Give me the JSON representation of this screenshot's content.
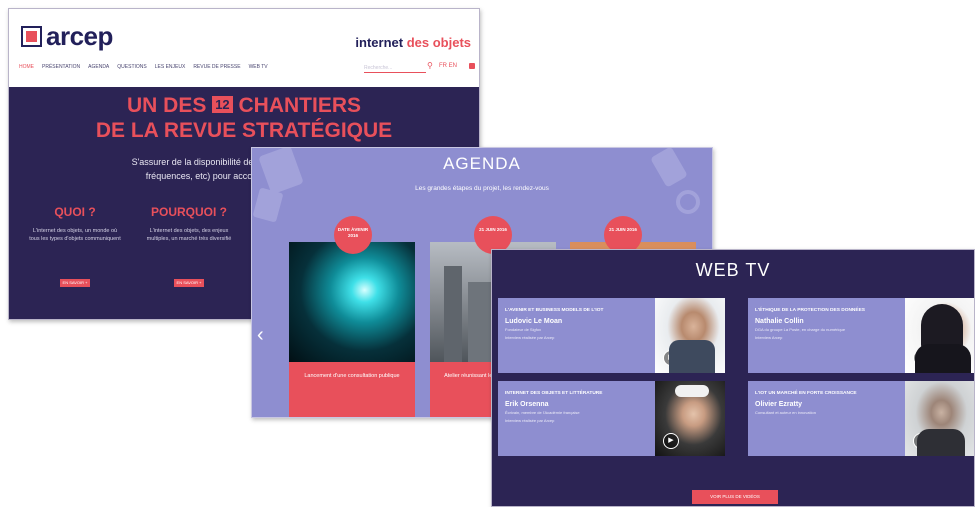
{
  "home": {
    "logo_text": "arcep",
    "header_brand_1": "internet",
    "header_brand_2": "des objets",
    "nav": [
      "HOME",
      "PRÉSENTATION",
      "AGENDA",
      "QUESTIONS",
      "LES ENJEUX",
      "REVUE DE PRESSE",
      "WEB TV"
    ],
    "search_placeholder": "Recherche...",
    "lang": "FR EN",
    "headline_1": "UN DES",
    "headline_num": "12",
    "headline_2": "CHANTIERS",
    "headline_3": "DE LA REVUE STRATÉGIQUE",
    "intro_1": "S'assurer de la disponibilité des ressources rares (num",
    "intro_2": "fréquences, etc) pour accompagner le développ",
    "columns": [
      {
        "title": "QUOI ?",
        "text": "L'internet des objets, un monde où tous les types d'objets communiquent",
        "button": "EN SAVOIR +"
      },
      {
        "title": "POURQUOI ?",
        "text": "L'internet des objets, des enjeux multiples, un marché très diversifié",
        "button": "EN SAVOIR +"
      }
    ]
  },
  "agenda": {
    "title": "AGENDA",
    "subtitle": "Les grandes étapes du projet, les rendez-vous",
    "prev_arrow": "‹",
    "cards": [
      {
        "date": "DATE ÀVENIR 2016",
        "caption": "Lancement d'une consultation publique"
      },
      {
        "date": "21 JUIN 2016",
        "caption": "Atelier réunissant les acteurs du secteur"
      },
      {
        "date": "21 JUIN 2016",
        "caption": ""
      }
    ]
  },
  "webtv": {
    "title": "WEB TV",
    "items": [
      {
        "title": "L'AVENIR ET BUSINESS MODELS DE L'IOT",
        "name": "Ludovic Le Moan",
        "role": "Fondateur de Sigfox",
        "detail": "Interview réalisée par Arcep"
      },
      {
        "title": "L'ÉTHIQUE DE LA PROTECTION DES DONNÉES",
        "name": "Nathalie Collin",
        "role": "DGA du groupe La Poste, en charge du numérique",
        "detail": "Interview Arcep"
      },
      {
        "title": "INTERNET DES OBJETS ET LITTÉRATURE",
        "name": "Erik Orsenna",
        "role": "Écrivain, membre de l'Académie française",
        "detail": "Interview réalisée par Arcep"
      },
      {
        "title": "L'IOT UN MARCHÉ EN FORTE CROISSANCE",
        "name": "Olivier Ezratty",
        "role": "Consultant et auteur en innovation",
        "detail": ""
      }
    ],
    "button": "VOIR PLUS DE VIDÉOS",
    "play_glyph": "▶"
  }
}
